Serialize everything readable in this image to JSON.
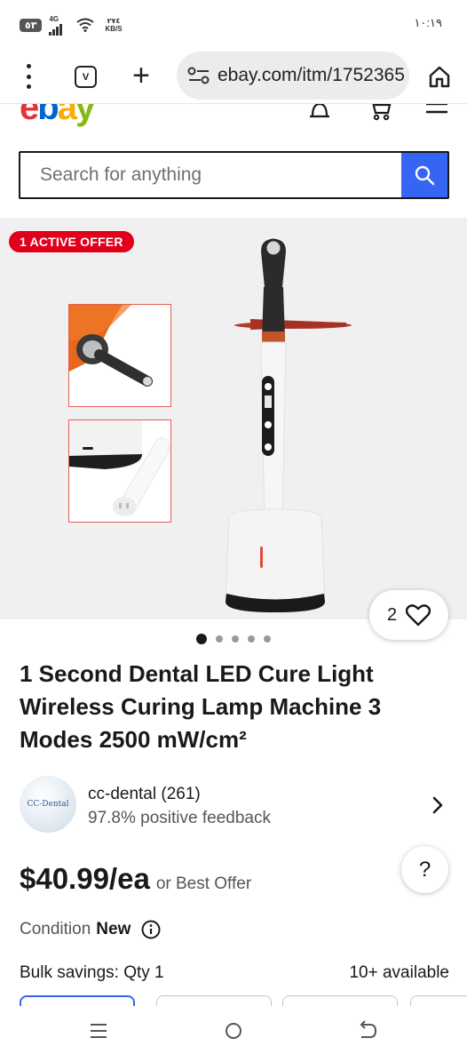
{
  "status_bar": {
    "battery": "٥٣",
    "network": "4G",
    "speed_value": "٢٧٤",
    "speed_unit": "KB/S",
    "time": "١٠:١٩"
  },
  "browser": {
    "tab_label": "V",
    "url": "ebay.com/itm/1752365"
  },
  "search": {
    "placeholder": "Search for anything"
  },
  "gallery": {
    "offer_badge": "1 ACTIVE OFFER",
    "watch_count": "2",
    "image_count": 5,
    "active_index": 0
  },
  "product": {
    "title": "1 Second Dental LED Cure Light Wireless Curing Lamp Machine 3 Modes 2500 mW/cm²"
  },
  "seller": {
    "avatar_text": "CC-Dental",
    "name": "cc-dental (261)",
    "feedback": "97.8% positive feedback"
  },
  "help": {
    "label": "?"
  },
  "pricing": {
    "price": "$40.99/ea",
    "best_offer": "or Best Offer"
  },
  "condition": {
    "label": "Condition",
    "value": "New"
  },
  "bulk": {
    "label": "Bulk savings: Qty 1",
    "available": "10+ available"
  },
  "colors": {
    "ebay_blue": "#3665f3",
    "badge_red": "#e0001b",
    "text": "#191919"
  }
}
